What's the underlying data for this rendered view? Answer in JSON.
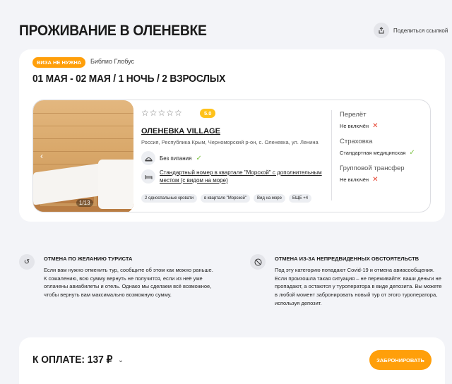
{
  "page": {
    "title": "ПРОЖИВАНИЕ В ОЛЕНЕВКЕ",
    "share_label": "Поделиться ссылкой"
  },
  "offer": {
    "visa_badge": "ВИЗА НЕ НУЖНА",
    "operator": "Библио Глобус",
    "dates": "01 МАЯ - 02 МАЯ / 1 НОЧЬ / 2 ВЗРОСЛЫХ"
  },
  "hotel": {
    "stars": "☆☆☆☆☆",
    "rating": "5.0",
    "name": "ОЛЕНЕВКА VILLAGE",
    "address": "Россия, Республика Крым, Черноморский р-он, с. Оленевка, ул. Ленина",
    "meal": "Без питания",
    "room_line1": "Стандартный номер в квартале \"Морской\" с дополнительным",
    "room_line2": "местом (с видом на море)",
    "photo_counter": "1/13",
    "tags": [
      "2 односпальные кровати",
      "в квартале \"Морской\"",
      "Вид на море",
      "ЕЩЕ +4"
    ]
  },
  "services": [
    {
      "title": "Перелёт",
      "value": "Не включён",
      "included": false
    },
    {
      "title": "Страховка",
      "value": "Стандартная медицинская",
      "included": true
    },
    {
      "title": "Групповой трансфер",
      "value": "Не включён",
      "included": false
    }
  ],
  "cancellation": {
    "tourist": {
      "title": "ОТМЕНА ПО ЖЕЛАНИЮ ТУРИСТА",
      "lines": [
        "Если вам нужно отменить тур, сообщите об этом как можно раньше.",
        "К сожалению, всю сумму вернуть не получится, если из неё уже",
        "оплачены авиабилеты и отель. Однако мы сделаем всё возможное,",
        "чтобы вернуть вам максимально возможную сумму."
      ]
    },
    "force_majeure": {
      "title": "ОТМЕНА ИЗ-ЗА НЕПРЕДВИДЕННЫХ ОБСТОЯТЕЛЬСТВ",
      "lines": [
        "Под эту категорию попадают Covid-19 и отмена авиасообщения.",
        "Если произошла такая ситуация – не переживайте: ваши деньги не",
        "пропадают, а остаются у туроператора в виде депозита. Вы можете",
        "в любой момент забронировать новый тур от этого туроператора,",
        "используя депозит."
      ]
    }
  },
  "footer": {
    "pay_label": "К ОПЛАТЕ: 137 ₽",
    "book_button": "ЗАБРОНИРОВАТЬ"
  },
  "colors": {
    "accent": "#ff9f0a",
    "rating": "#ffc21a",
    "check": "#7cc242",
    "cross": "#e6422f"
  }
}
